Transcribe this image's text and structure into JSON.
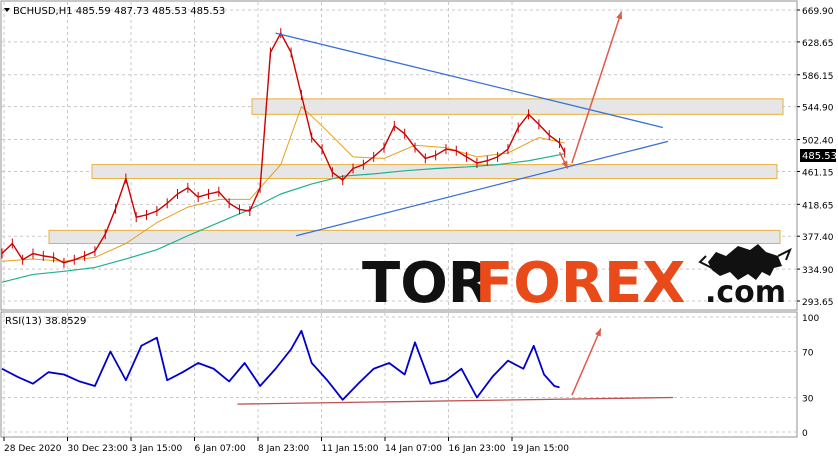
{
  "chart_data": [
    {
      "type": "line",
      "title": "BCHUSD,H1  485.59 487.73 485.53 485.53",
      "symbol": "BCHUSD",
      "timeframe": "H1",
      "ohlc": {
        "open": 485.59,
        "high": 487.73,
        "low": 485.53,
        "close": 485.53
      },
      "last_price_label": "485.53",
      "ylim": [
        293.65,
        669.9
      ],
      "y_ticks": [
        "669.90",
        "628.65",
        "586.15",
        "544.90",
        "502.40",
        "461.15",
        "418.65",
        "377.40",
        "334.90",
        "293.65"
      ],
      "x_ticks": [
        "28 Dec 2020",
        "30 Dec 23:00",
        "3 Jan 15:00",
        "6 Jan 07:00",
        "8 Jan 23:00",
        "11 Jan 15:00",
        "14 Jan 07:00",
        "16 Jan 23:00",
        "19 Jan 15:00"
      ],
      "grid": true,
      "series": [
        {
          "name": "",
          "color": "#cc0000",
          "x": [
            0,
            10,
            20,
            30,
            40,
            50,
            60,
            70,
            80,
            90,
            100,
            110,
            120,
            130,
            140,
            150,
            160,
            170,
            180,
            190,
            200,
            210,
            220,
            230,
            240,
            250,
            260,
            270,
            280,
            290,
            300,
            310,
            320,
            330,
            340,
            350,
            360,
            370,
            380,
            390,
            400,
            410,
            420,
            430,
            440,
            450,
            460,
            470,
            480,
            490,
            500,
            510,
            520,
            530,
            540,
            545
          ],
          "values": [
            355,
            368,
            347,
            355,
            352,
            350,
            343,
            347,
            352,
            358,
            380,
            413,
            452,
            402,
            405,
            410,
            420,
            432,
            440,
            428,
            432,
            435,
            420,
            412,
            410,
            440,
            615,
            640,
            615,
            560,
            505,
            490,
            460,
            450,
            465,
            470,
            480,
            492,
            520,
            510,
            492,
            478,
            482,
            490,
            488,
            480,
            472,
            475,
            480,
            490,
            518,
            535,
            522,
            508,
            498,
            485.53
          ]
        },
        {
          "name": "",
          "color": "#e6a020",
          "x": [
            0,
            30,
            60,
            90,
            120,
            150,
            180,
            210,
            240,
            270,
            290,
            310,
            340,
            370,
            400,
            430,
            460,
            490,
            520,
            545
          ],
          "values": [
            345,
            348,
            345,
            350,
            368,
            395,
            415,
            425,
            425,
            470,
            545,
            520,
            480,
            478,
            495,
            492,
            480,
            485,
            505,
            498
          ]
        },
        {
          "name": "",
          "color": "#20b090",
          "x": [
            0,
            30,
            60,
            90,
            120,
            150,
            180,
            210,
            240,
            270,
            300,
            330,
            360,
            390,
            420,
            450,
            480,
            510,
            545
          ],
          "values": [
            318,
            328,
            332,
            337,
            348,
            360,
            378,
            395,
            412,
            432,
            445,
            455,
            458,
            462,
            465,
            467,
            470,
            475,
            484
          ]
        }
      ],
      "support_resistance_zones": [
        {
          "from": 535,
          "to": 555
        },
        {
          "from": 452,
          "to": 470
        },
        {
          "from": 368,
          "to": 385
        }
      ],
      "triangle": {
        "upper": {
          "from": [
            265,
            640
          ],
          "to": [
            640,
            518
          ]
        },
        "lower": {
          "from": [
            285,
            378
          ],
          "to": [
            645,
            500
          ]
        }
      },
      "projection_arrows": [
        {
          "from": [
            540,
            486
          ],
          "to": [
            548,
            465
          ]
        },
        {
          "from": [
            552,
            472
          ],
          "to": [
            600,
            668
          ]
        }
      ]
    },
    {
      "type": "line",
      "title": "RSI(13) 38.8529",
      "ylim": [
        0,
        100
      ],
      "y_ticks": [
        "100",
        "70",
        "30",
        "0"
      ],
      "series": [
        {
          "name": "RSI(13)",
          "color": "#0000cc",
          "x": [
            0,
            15,
            30,
            45,
            60,
            75,
            90,
            105,
            120,
            135,
            150,
            160,
            175,
            190,
            205,
            220,
            235,
            250,
            265,
            280,
            290,
            300,
            315,
            330,
            345,
            360,
            375,
            390,
            400,
            415,
            430,
            445,
            460,
            475,
            490,
            505,
            515,
            525,
            535,
            540
          ],
          "values": [
            55,
            48,
            42,
            52,
            50,
            44,
            40,
            70,
            45,
            75,
            82,
            45,
            52,
            60,
            55,
            44,
            60,
            40,
            55,
            72,
            88,
            60,
            45,
            28,
            42,
            55,
            60,
            50,
            78,
            42,
            45,
            55,
            30,
            48,
            62,
            55,
            75,
            50,
            40,
            38.85
          ]
        }
      ],
      "trend_line": {
        "from": [
          228,
          26
        ],
        "to": [
          650,
          30
        ]
      },
      "arrow": {
        "from": [
          552,
          32
        ],
        "to": [
          580,
          90
        ]
      }
    }
  ],
  "watermark": {
    "text_left": "TOR",
    "text_right": "FOREX",
    "suffix": ".com"
  },
  "colors": {
    "background": "#ffffff",
    "grid": "#c8c8c8",
    "axis_text": "#000000",
    "price": "#cc0000",
    "ma_orange": "#e6a020",
    "ma_green": "#20b090",
    "rsi": "#0000cc",
    "trend_blue": "#3a6fd8",
    "arrow_red": "#e05a4a",
    "zone_fill": "#e6e6e6",
    "zone_border": "#e8b040",
    "logo_black": "#111111",
    "logo_red": "#e84a1a"
  }
}
